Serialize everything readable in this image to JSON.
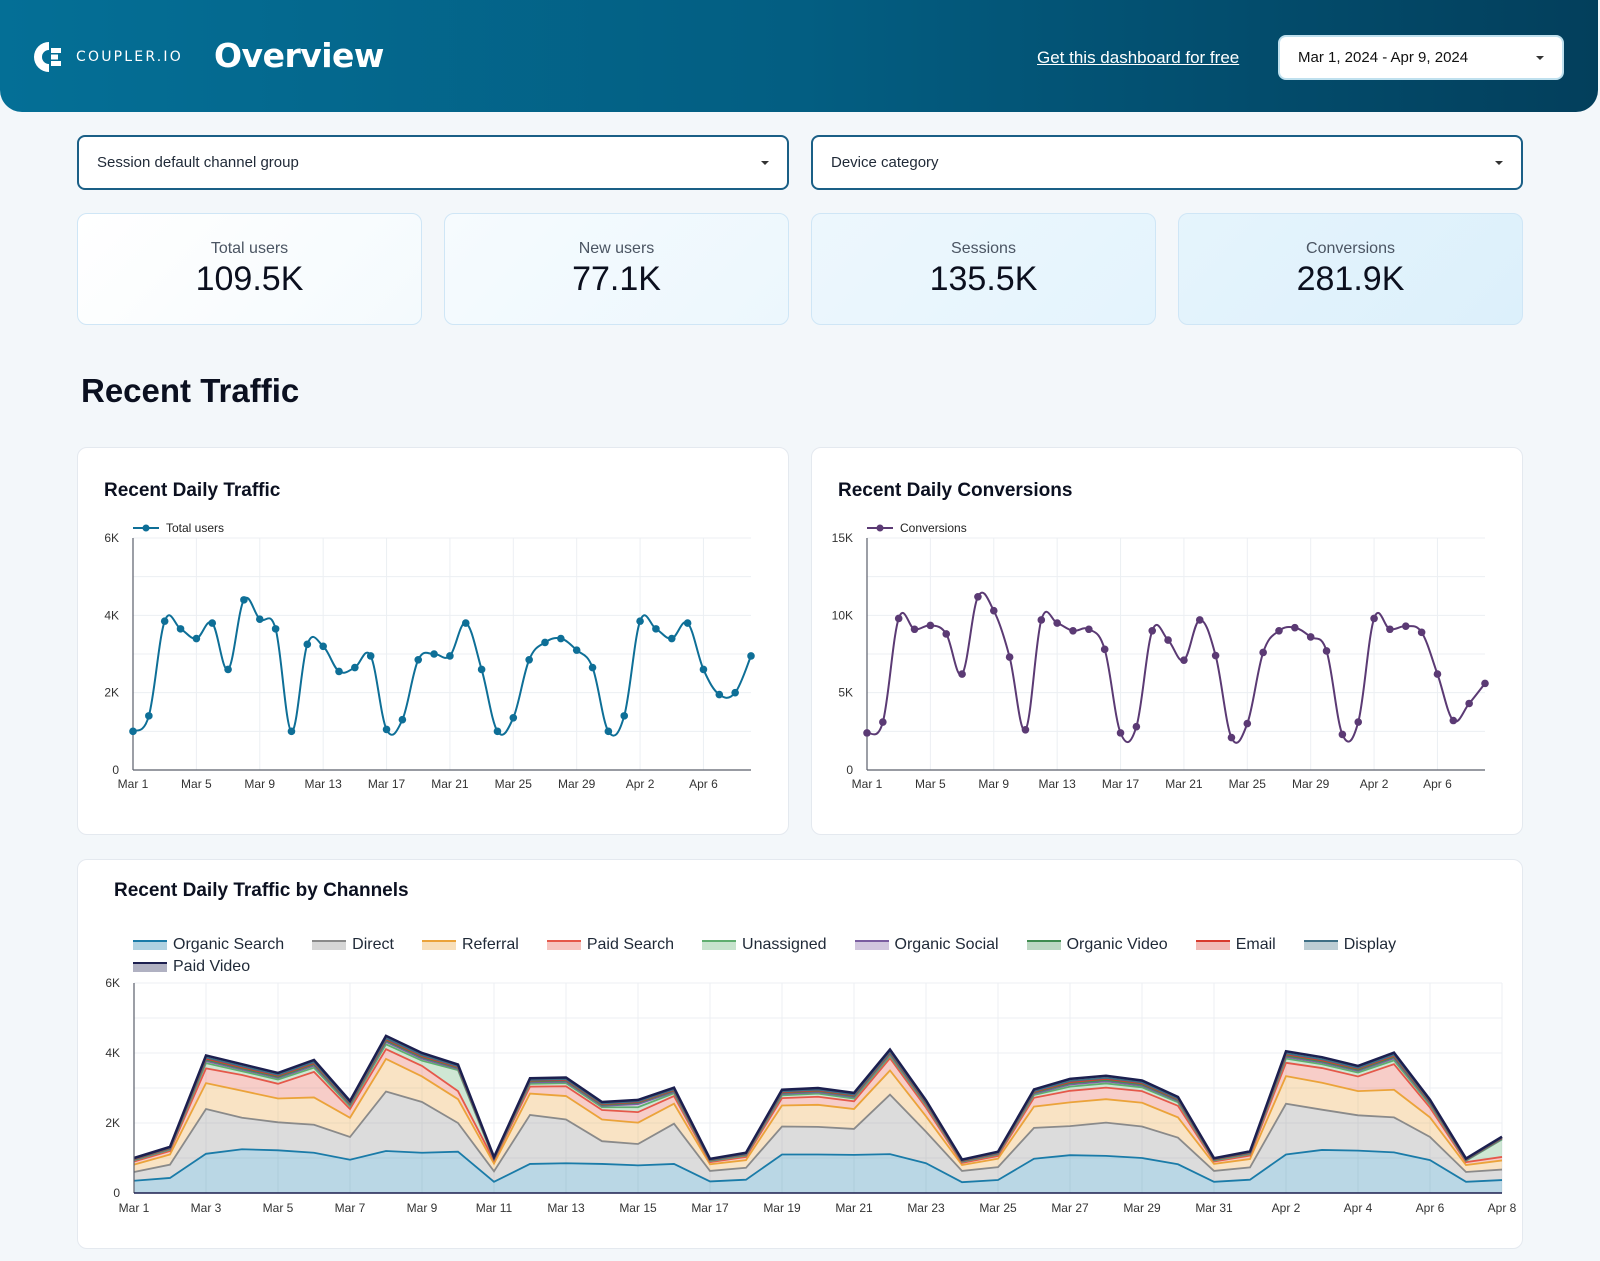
{
  "header": {
    "brand": "COUPLER.IO",
    "title": "Overview",
    "cta_link": "Get this dashboard for free",
    "date_range": "Mar 1, 2024 - Apr 9, 2024"
  },
  "filters": [
    {
      "label": "Session default channel group"
    },
    {
      "label": "Device category"
    }
  ],
  "kpis": [
    {
      "label": "Total users",
      "value": "109.5K"
    },
    {
      "label": "New users",
      "value": "77.1K"
    },
    {
      "label": "Sessions",
      "value": "135.5K"
    },
    {
      "label": "Conversions",
      "value": "281.9K"
    }
  ],
  "section_title": "Recent Traffic",
  "chart_data": [
    {
      "type": "line",
      "title": "Recent Daily Traffic",
      "xlabel": "",
      "ylabel": "",
      "ylim": [
        0,
        6000
      ],
      "yticks": [
        0,
        2000,
        4000,
        6000
      ],
      "ytick_labels": [
        "0",
        "2K",
        "4K",
        "6K"
      ],
      "xtick_labels": [
        "Mar 1",
        "Mar 5",
        "Mar 9",
        "Mar 13",
        "Mar 17",
        "Mar 21",
        "Mar 25",
        "Mar 29",
        "Apr 2",
        "Apr 6"
      ],
      "grid": true,
      "legend": "top-left",
      "color": "#0e6f97",
      "series": [
        {
          "name": "Total users",
          "values": [
            1000,
            1400,
            3850,
            3650,
            3400,
            3800,
            2600,
            4400,
            3900,
            3650,
            1000,
            3250,
            3200,
            2550,
            2650,
            2950,
            1050,
            1300,
            2850,
            3000,
            2950,
            3800,
            2600,
            1000,
            1350,
            2850,
            3300,
            3400,
            3100,
            2650,
            1000,
            1400,
            3850,
            3650,
            3400,
            3800,
            2600,
            1950,
            2000,
            2950
          ]
        }
      ]
    },
    {
      "type": "line",
      "title": "Recent Daily Conversions",
      "xlabel": "",
      "ylabel": "",
      "ylim": [
        0,
        15000
      ],
      "yticks": [
        0,
        5000,
        10000,
        15000
      ],
      "ytick_labels": [
        "0",
        "5K",
        "10K",
        "15K"
      ],
      "xtick_labels": [
        "Mar 1",
        "Mar 5",
        "Mar 9",
        "Mar 13",
        "Mar 17",
        "Mar 21",
        "Mar 25",
        "Mar 29",
        "Apr 2",
        "Apr 6"
      ],
      "grid": true,
      "legend": "top-left",
      "color": "#5b3a74",
      "series": [
        {
          "name": "Conversions",
          "values": [
            2400,
            3100,
            9800,
            9100,
            9350,
            8800,
            6200,
            11200,
            10300,
            7300,
            2600,
            9700,
            9500,
            9000,
            9100,
            7800,
            2400,
            2800,
            9000,
            8400,
            7100,
            9700,
            7400,
            2100,
            3000,
            7600,
            9000,
            9200,
            8600,
            7700,
            2300,
            3100,
            9800,
            9100,
            9300,
            8900,
            6200,
            3200,
            4300,
            5600
          ]
        }
      ]
    },
    {
      "type": "area",
      "stacked": true,
      "title": "Recent Daily Traffic by Channels",
      "xlabel": "",
      "ylabel": "",
      "ylim": [
        0,
        6000
      ],
      "yticks": [
        0,
        2000,
        4000,
        6000
      ],
      "ytick_labels": [
        "0",
        "2K",
        "4K",
        "6K"
      ],
      "xtick_labels": [
        "Mar 1",
        "Mar 3",
        "Mar 5",
        "Mar 7",
        "Mar 9",
        "Mar 11",
        "Mar 13",
        "Mar 15",
        "Mar 17",
        "Mar 19",
        "Mar 21",
        "Mar 23",
        "Mar 25",
        "Mar 27",
        "Mar 29",
        "Mar 31",
        "Apr 2",
        "Apr 4",
        "Apr 6",
        "Apr 8"
      ],
      "grid": true,
      "legend": "top",
      "series": [
        {
          "name": "Organic Search",
          "color": "#1a7ba8",
          "values": [
            350,
            430,
            1120,
            1250,
            1220,
            1150,
            950,
            1200,
            1150,
            1180,
            320,
            830,
            850,
            830,
            790,
            830,
            330,
            380,
            1100,
            1100,
            1090,
            1110,
            850,
            310,
            370,
            980,
            1080,
            1060,
            1000,
            820,
            320,
            380,
            1100,
            1230,
            1210,
            1160,
            940,
            320,
            370
          ]
        },
        {
          "name": "Direct",
          "color": "#8a8a8a",
          "values": [
            250,
            380,
            1280,
            900,
            800,
            800,
            650,
            1700,
            1450,
            820,
            300,
            1400,
            1250,
            650,
            610,
            1150,
            300,
            340,
            800,
            790,
            740,
            1700,
            900,
            320,
            370,
            880,
            830,
            950,
            900,
            760,
            310,
            350,
            1450,
            1150,
            1010,
            1000,
            660,
            280,
            300
          ]
        },
        {
          "name": "Referral",
          "color": "#eba33a",
          "values": [
            210,
            290,
            740,
            770,
            680,
            780,
            550,
            930,
            730,
            680,
            220,
            610,
            670,
            620,
            610,
            570,
            190,
            220,
            600,
            630,
            570,
            690,
            440,
            170,
            240,
            610,
            680,
            670,
            680,
            580,
            200,
            240,
            790,
            770,
            690,
            790,
            560,
            200,
            260
          ]
        },
        {
          "name": "Paid Search",
          "color": "#e5584a",
          "values": [
            90,
            100,
            420,
            450,
            420,
            730,
            250,
            280,
            300,
            230,
            90,
            200,
            280,
            270,
            300,
            220,
            60,
            90,
            210,
            230,
            220,
            350,
            250,
            60,
            80,
            250,
            330,
            330,
            330,
            330,
            70,
            100,
            380,
            420,
            420,
            730,
            280,
            80,
            100
          ]
        },
        {
          "name": "Unassigned",
          "color": "#5fae6f",
          "values": [
            30,
            40,
            150,
            110,
            120,
            120,
            80,
            140,
            150,
            600,
            30,
            80,
            90,
            80,
            140,
            80,
            30,
            40,
            80,
            90,
            80,
            70,
            70,
            30,
            40,
            80,
            120,
            120,
            110,
            100,
            30,
            40,
            120,
            110,
            110,
            110,
            80,
            40,
            500
          ]
        },
        {
          "name": "Organic Social",
          "color": "#7a5da0",
          "values": [
            20,
            20,
            60,
            50,
            50,
            60,
            40,
            70,
            60,
            40,
            15,
            40,
            40,
            40,
            90,
            40,
            15,
            20,
            40,
            40,
            40,
            50,
            35,
            15,
            20,
            40,
            60,
            60,
            50,
            40,
            15,
            20,
            50,
            50,
            50,
            60,
            40,
            15,
            20
          ]
        },
        {
          "name": "Organic Video",
          "color": "#3f8c4f",
          "values": [
            10,
            15,
            40,
            30,
            30,
            40,
            25,
            40,
            40,
            30,
            10,
            30,
            30,
            30,
            40,
            30,
            10,
            15,
            30,
            30,
            30,
            30,
            25,
            10,
            15,
            30,
            40,
            40,
            35,
            30,
            10,
            15,
            40,
            30,
            30,
            40,
            25,
            10,
            15
          ]
        },
        {
          "name": "Email",
          "color": "#d83b2d",
          "values": [
            10,
            10,
            30,
            30,
            30,
            30,
            20,
            30,
            30,
            20,
            10,
            20,
            20,
            20,
            20,
            20,
            10,
            10,
            20,
            20,
            20,
            20,
            20,
            10,
            10,
            20,
            30,
            30,
            30,
            20,
            10,
            10,
            30,
            30,
            30,
            30,
            20,
            10,
            10
          ]
        },
        {
          "name": "Display",
          "color": "#3e6f85",
          "values": [
            10,
            10,
            30,
            30,
            25,
            30,
            20,
            30,
            30,
            20,
            10,
            20,
            20,
            20,
            20,
            20,
            10,
            10,
            20,
            20,
            20,
            20,
            20,
            10,
            10,
            20,
            30,
            30,
            25,
            20,
            10,
            10,
            30,
            30,
            25,
            30,
            20,
            10,
            10
          ]
        },
        {
          "name": "Paid Video",
          "color": "#1c1f4f",
          "values": [
            20,
            25,
            60,
            60,
            55,
            60,
            45,
            70,
            60,
            50,
            20,
            50,
            50,
            40,
            40,
            50,
            20,
            25,
            50,
            50,
            50,
            60,
            40,
            20,
            25,
            50,
            60,
            60,
            55,
            45,
            20,
            25,
            60,
            60,
            55,
            60,
            40,
            20,
            25
          ]
        }
      ]
    }
  ]
}
